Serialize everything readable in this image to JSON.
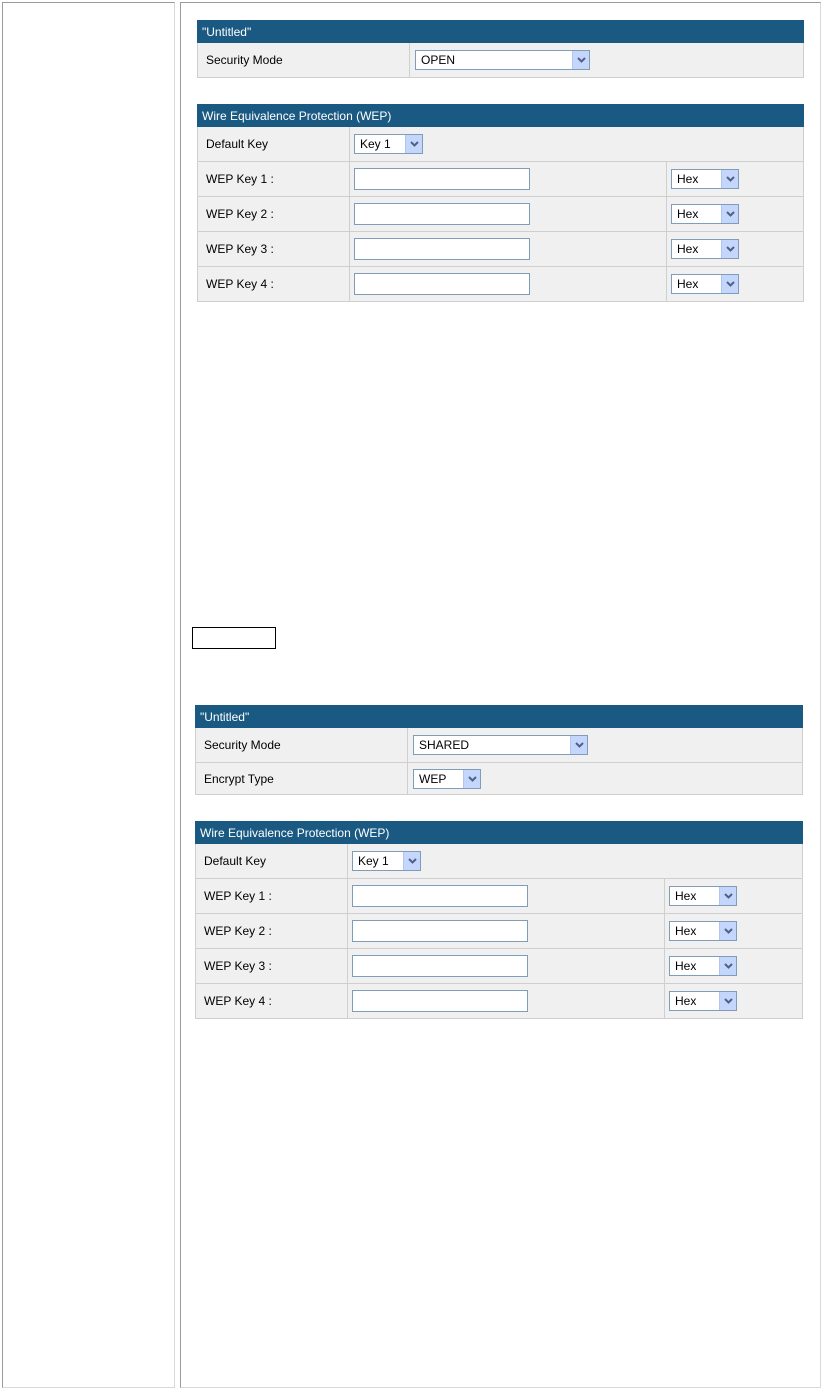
{
  "screens": [
    {
      "title": "\"Untitled\"",
      "rows": [
        {
          "label": "Security Mode",
          "value": "OPEN"
        }
      ],
      "wep": {
        "title": "Wire Equivalence Protection (WEP)",
        "default_key_label": "Default Key",
        "default_key_value": "Key 1",
        "keys": [
          {
            "label": "WEP Key 1 :",
            "value": "",
            "format": "Hex"
          },
          {
            "label": "WEP Key 2 :",
            "value": "",
            "format": "Hex"
          },
          {
            "label": "WEP Key 3 :",
            "value": "",
            "format": "Hex"
          },
          {
            "label": "WEP Key 4 :",
            "value": "",
            "format": "Hex"
          }
        ]
      }
    },
    {
      "title": "\"Untitled\"",
      "rows": [
        {
          "label": "Security Mode",
          "value": "SHARED"
        },
        {
          "label": "Encrypt Type",
          "value": "WEP"
        }
      ],
      "wep": {
        "title": "Wire Equivalence Protection (WEP)",
        "default_key_label": "Default Key",
        "default_key_value": "Key 1",
        "keys": [
          {
            "label": "WEP Key 1 :",
            "value": "",
            "format": "Hex"
          },
          {
            "label": "WEP Key 2 :",
            "value": "",
            "format": "Hex"
          },
          {
            "label": "WEP Key 3 :",
            "value": "",
            "format": "Hex"
          },
          {
            "label": "WEP Key 4 :",
            "value": "",
            "format": "Hex"
          }
        ]
      }
    }
  ],
  "icons": {
    "dropdown": "chevron-down-icon"
  },
  "colors": {
    "header_bg": "#1a5a82",
    "row_bg": "#f0f0f0",
    "select_arrow_bg": "#c5d6fc",
    "field_border": "#7f9db9"
  }
}
